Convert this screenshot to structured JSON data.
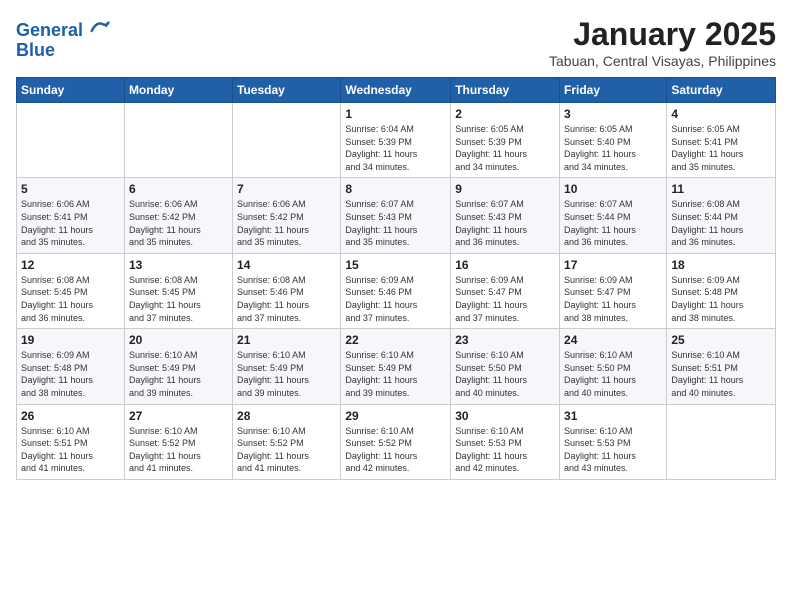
{
  "logo": {
    "line1": "General",
    "line2": "Blue"
  },
  "title": "January 2025",
  "location": "Tabuan, Central Visayas, Philippines",
  "days_of_week": [
    "Sunday",
    "Monday",
    "Tuesday",
    "Wednesday",
    "Thursday",
    "Friday",
    "Saturday"
  ],
  "weeks": [
    [
      {
        "day": "",
        "info": ""
      },
      {
        "day": "",
        "info": ""
      },
      {
        "day": "",
        "info": ""
      },
      {
        "day": "1",
        "info": "Sunrise: 6:04 AM\nSunset: 5:39 PM\nDaylight: 11 hours\nand 34 minutes."
      },
      {
        "day": "2",
        "info": "Sunrise: 6:05 AM\nSunset: 5:39 PM\nDaylight: 11 hours\nand 34 minutes."
      },
      {
        "day": "3",
        "info": "Sunrise: 6:05 AM\nSunset: 5:40 PM\nDaylight: 11 hours\nand 34 minutes."
      },
      {
        "day": "4",
        "info": "Sunrise: 6:05 AM\nSunset: 5:41 PM\nDaylight: 11 hours\nand 35 minutes."
      }
    ],
    [
      {
        "day": "5",
        "info": "Sunrise: 6:06 AM\nSunset: 5:41 PM\nDaylight: 11 hours\nand 35 minutes."
      },
      {
        "day": "6",
        "info": "Sunrise: 6:06 AM\nSunset: 5:42 PM\nDaylight: 11 hours\nand 35 minutes."
      },
      {
        "day": "7",
        "info": "Sunrise: 6:06 AM\nSunset: 5:42 PM\nDaylight: 11 hours\nand 35 minutes."
      },
      {
        "day": "8",
        "info": "Sunrise: 6:07 AM\nSunset: 5:43 PM\nDaylight: 11 hours\nand 35 minutes."
      },
      {
        "day": "9",
        "info": "Sunrise: 6:07 AM\nSunset: 5:43 PM\nDaylight: 11 hours\nand 36 minutes."
      },
      {
        "day": "10",
        "info": "Sunrise: 6:07 AM\nSunset: 5:44 PM\nDaylight: 11 hours\nand 36 minutes."
      },
      {
        "day": "11",
        "info": "Sunrise: 6:08 AM\nSunset: 5:44 PM\nDaylight: 11 hours\nand 36 minutes."
      }
    ],
    [
      {
        "day": "12",
        "info": "Sunrise: 6:08 AM\nSunset: 5:45 PM\nDaylight: 11 hours\nand 36 minutes."
      },
      {
        "day": "13",
        "info": "Sunrise: 6:08 AM\nSunset: 5:45 PM\nDaylight: 11 hours\nand 37 minutes."
      },
      {
        "day": "14",
        "info": "Sunrise: 6:08 AM\nSunset: 5:46 PM\nDaylight: 11 hours\nand 37 minutes."
      },
      {
        "day": "15",
        "info": "Sunrise: 6:09 AM\nSunset: 5:46 PM\nDaylight: 11 hours\nand 37 minutes."
      },
      {
        "day": "16",
        "info": "Sunrise: 6:09 AM\nSunset: 5:47 PM\nDaylight: 11 hours\nand 37 minutes."
      },
      {
        "day": "17",
        "info": "Sunrise: 6:09 AM\nSunset: 5:47 PM\nDaylight: 11 hours\nand 38 minutes."
      },
      {
        "day": "18",
        "info": "Sunrise: 6:09 AM\nSunset: 5:48 PM\nDaylight: 11 hours\nand 38 minutes."
      }
    ],
    [
      {
        "day": "19",
        "info": "Sunrise: 6:09 AM\nSunset: 5:48 PM\nDaylight: 11 hours\nand 38 minutes."
      },
      {
        "day": "20",
        "info": "Sunrise: 6:10 AM\nSunset: 5:49 PM\nDaylight: 11 hours\nand 39 minutes."
      },
      {
        "day": "21",
        "info": "Sunrise: 6:10 AM\nSunset: 5:49 PM\nDaylight: 11 hours\nand 39 minutes."
      },
      {
        "day": "22",
        "info": "Sunrise: 6:10 AM\nSunset: 5:49 PM\nDaylight: 11 hours\nand 39 minutes."
      },
      {
        "day": "23",
        "info": "Sunrise: 6:10 AM\nSunset: 5:50 PM\nDaylight: 11 hours\nand 40 minutes."
      },
      {
        "day": "24",
        "info": "Sunrise: 6:10 AM\nSunset: 5:50 PM\nDaylight: 11 hours\nand 40 minutes."
      },
      {
        "day": "25",
        "info": "Sunrise: 6:10 AM\nSunset: 5:51 PM\nDaylight: 11 hours\nand 40 minutes."
      }
    ],
    [
      {
        "day": "26",
        "info": "Sunrise: 6:10 AM\nSunset: 5:51 PM\nDaylight: 11 hours\nand 41 minutes."
      },
      {
        "day": "27",
        "info": "Sunrise: 6:10 AM\nSunset: 5:52 PM\nDaylight: 11 hours\nand 41 minutes."
      },
      {
        "day": "28",
        "info": "Sunrise: 6:10 AM\nSunset: 5:52 PM\nDaylight: 11 hours\nand 41 minutes."
      },
      {
        "day": "29",
        "info": "Sunrise: 6:10 AM\nSunset: 5:52 PM\nDaylight: 11 hours\nand 42 minutes."
      },
      {
        "day": "30",
        "info": "Sunrise: 6:10 AM\nSunset: 5:53 PM\nDaylight: 11 hours\nand 42 minutes."
      },
      {
        "day": "31",
        "info": "Sunrise: 6:10 AM\nSunset: 5:53 PM\nDaylight: 11 hours\nand 43 minutes."
      },
      {
        "day": "",
        "info": ""
      }
    ]
  ]
}
